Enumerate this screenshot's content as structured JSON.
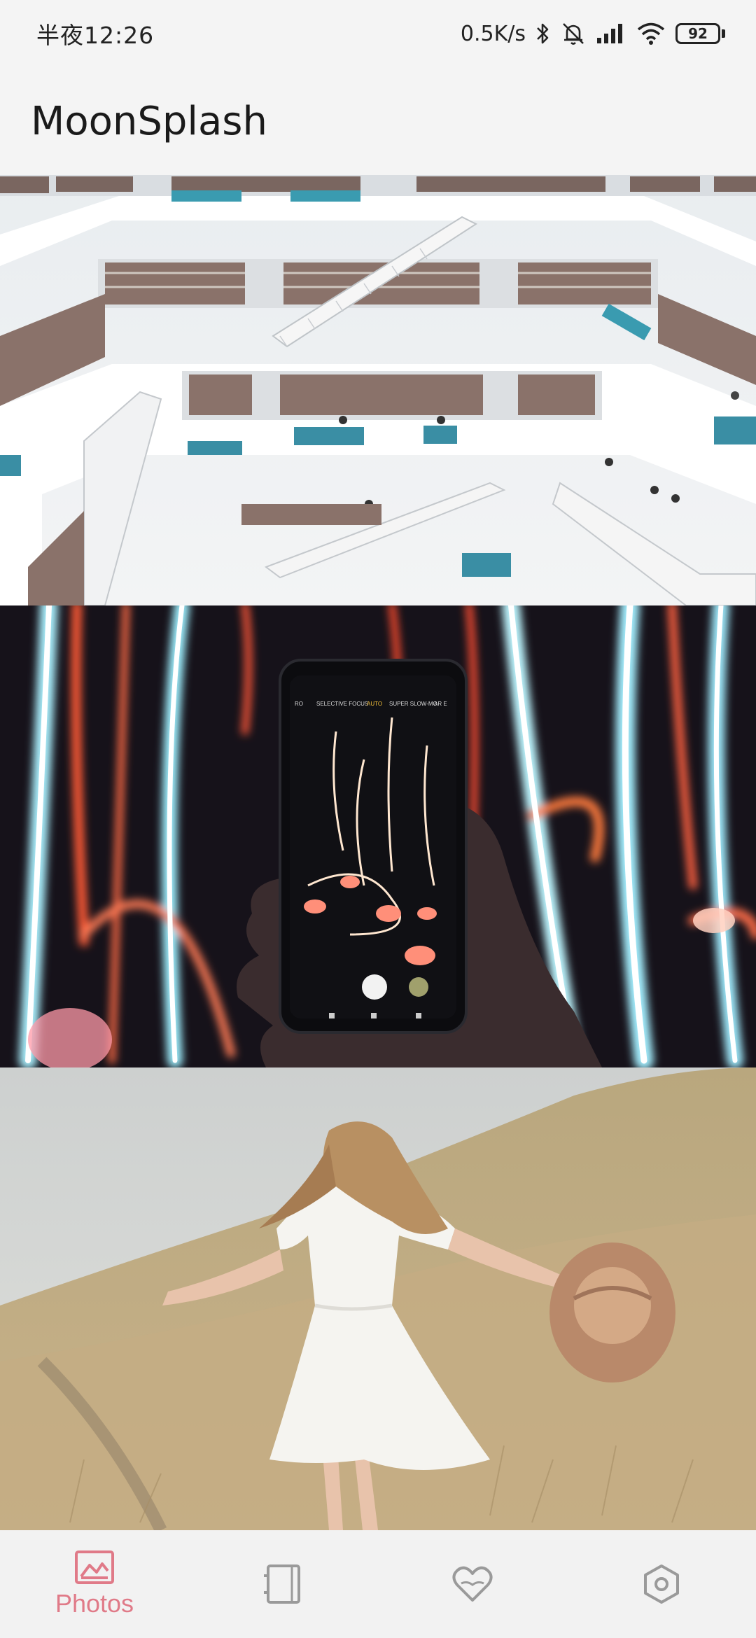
{
  "status_bar": {
    "time": "半夜12:26",
    "network_speed": "0.5K/s",
    "battery": "92",
    "icons": [
      "bluetooth-icon",
      "mute-icon",
      "signal-icon",
      "wifi-icon",
      "battery-icon"
    ]
  },
  "app": {
    "title": "MoonSplash"
  },
  "feed": {
    "photos": [
      {
        "subject": "library-atrium",
        "icon": "photo"
      },
      {
        "subject": "neon-phone",
        "icon": "photo"
      },
      {
        "subject": "girl-in-field",
        "icon": "photo"
      }
    ]
  },
  "bottom_nav": {
    "items": [
      {
        "label": "Photos",
        "icon": "image-icon",
        "active": true
      },
      {
        "label": "",
        "icon": "collection-icon",
        "active": false
      },
      {
        "label": "",
        "icon": "heart-icon",
        "active": false
      },
      {
        "label": "",
        "icon": "settings-icon",
        "active": false
      }
    ],
    "active_color": "#e07a88",
    "inactive_color": "#9a9a9a"
  }
}
